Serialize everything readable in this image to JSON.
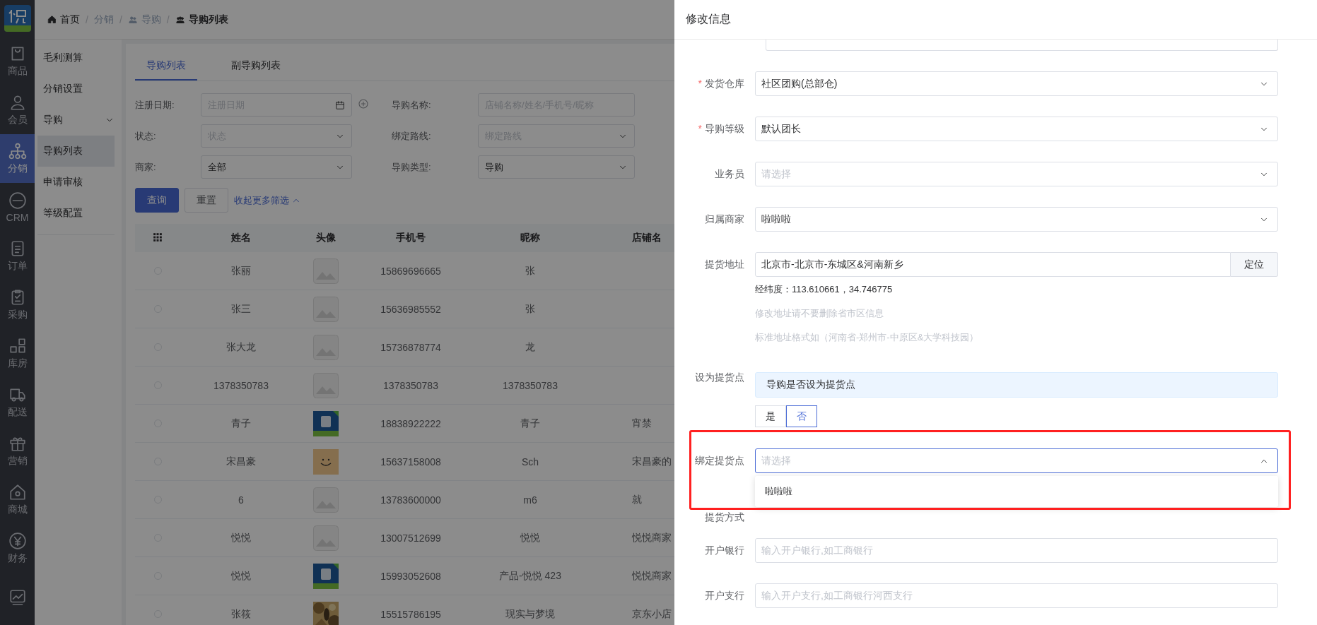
{
  "rail": {
    "items": [
      {
        "label": "商品",
        "selected": false
      },
      {
        "label": "会员",
        "selected": false
      },
      {
        "label": "分销",
        "selected": true
      },
      {
        "label": "CRM",
        "selected": false
      },
      {
        "label": "订单",
        "selected": false
      },
      {
        "label": "采购",
        "selected": false
      },
      {
        "label": "库房",
        "selected": false
      },
      {
        "label": "配送",
        "selected": false
      },
      {
        "label": "营销",
        "selected": false
      },
      {
        "label": "商城",
        "selected": false
      },
      {
        "label": "财务",
        "selected": false
      },
      {
        "selected": false
      }
    ]
  },
  "breadcrumb": [
    {
      "label": "首页"
    },
    {
      "separator": "/",
      "label": "分销"
    },
    {
      "separator": "/",
      "label": "导购"
    },
    {
      "separator": "/",
      "label": "导购列表"
    }
  ],
  "submenu": {
    "items": [
      {
        "label": "毛利测算",
        "selected": false
      },
      {
        "label": "分销设置",
        "selected": false
      },
      {
        "label": "导购",
        "selected": false,
        "expanded": true,
        "children": [
          {
            "label": "导购列表",
            "selected": true
          },
          {
            "label": "申请审核",
            "selected": false
          },
          {
            "label": "等级配置",
            "selected": false
          }
        ]
      }
    ]
  },
  "tabs": [
    {
      "label": "导购列表",
      "selected": true
    },
    {
      "label": "副导购列表",
      "selected": false
    }
  ],
  "filters": [
    {
      "label": "注册日期:",
      "kind": "date",
      "placeholder": "注册日期"
    },
    {
      "label": "导购名称:",
      "kind": "text",
      "placeholder": "店铺名称/姓名/手机号/昵称"
    },
    {
      "label": "状态:",
      "kind": "select",
      "placeholder": "状态"
    },
    {
      "label": "绑定路线:",
      "kind": "select",
      "placeholder": "绑定路线"
    },
    {
      "label": "商家:",
      "kind": "select",
      "value": "全部"
    },
    {
      "label": "导购类型:",
      "kind": "select",
      "value": "导购"
    }
  ],
  "filter_actions": {
    "query": "查询",
    "reset": "重置",
    "toggle": "收起更多筛选"
  },
  "table": {
    "columns": [
      "姓名",
      "头像",
      "手机号",
      "昵称",
      "店铺名"
    ],
    "rows": [
      {
        "selected": false,
        "name": "张丽",
        "avatar": {
          "kind": "placeholder"
        },
        "phone": "15869696665",
        "nickname": "张"
      },
      {
        "selected": false,
        "name": "张三",
        "avatar": {
          "kind": "placeholder"
        },
        "phone": "15636985552",
        "nickname": "张"
      },
      {
        "selected": false,
        "name": "张大龙",
        "avatar": {
          "kind": "placeholder"
        },
        "phone": "15736878774",
        "nickname": "龙"
      },
      {
        "selected": false,
        "name": "1378350783",
        "avatar": {
          "kind": "placeholder"
        },
        "phone": "1378350783",
        "nickname": "1378350783"
      },
      {
        "selected": false,
        "name": "青子",
        "avatar": {
          "kind": "logo"
        },
        "phone": "18838922222",
        "nickname": "青子",
        "store": "宵禁"
      },
      {
        "selected": false,
        "name": "宋昌豪",
        "avatar": {
          "kind": "smiley"
        },
        "phone": "15637158008",
        "nickname": "Sch",
        "store": "宋昌豪的"
      },
      {
        "selected": false,
        "name": "6",
        "avatar": {
          "kind": "placeholder"
        },
        "phone": "13783600000",
        "nickname": "m6",
        "store": "就"
      },
      {
        "selected": false,
        "name": "悦悦",
        "avatar": {
          "kind": "placeholder"
        },
        "phone": "13007512699",
        "nickname": "悦悦",
        "store": "悦悦商家"
      },
      {
        "selected": false,
        "name": "悦悦",
        "avatar": {
          "kind": "logo"
        },
        "phone": "15993052608",
        "nickname": "产品-悦悦 423",
        "store": "悦悦商家"
      },
      {
        "selected": false,
        "name": "张筱",
        "phone": "15515786195",
        "nickname": "现实与梦境",
        "store": "京东小店"
      }
    ]
  },
  "drawer": {
    "title": "修改信息",
    "fields": [
      {
        "label": "发货仓库",
        "required_mark": "*",
        "kind": "select",
        "value": "社区团购(总部仓)",
        "expanded": false,
        "highlighted": false
      },
      {
        "label": "导购等级",
        "required_mark": "*",
        "kind": "select",
        "value": "默认团长",
        "expanded": false,
        "highlighted": false
      },
      {
        "label": "业务员",
        "kind": "select",
        "placeholder": "请选择",
        "expanded": false,
        "highlighted": false
      },
      {
        "label": "归属商家",
        "kind": "select",
        "value": "啦啦啦",
        "expanded": false,
        "highlighted": false
      },
      {
        "label": "提货地址",
        "kind": "address",
        "value": "北京市-北京市-东城区&河南新乡",
        "button": "定位",
        "coords": "经纬度：113.610661，34.746775",
        "hints": [
          "修改地址请不要删除省市区信息",
          "标准地址格式如（河南省-郑州市-中原区&大学科技园）"
        ],
        "highlighted": false
      },
      {
        "label": "设为提货点",
        "kind": "choice",
        "notice": "导购是否设为提货点",
        "options": [
          {
            "label": "是",
            "selected": false
          },
          {
            "label": "否",
            "selected": true
          }
        ],
        "highlighted": false
      },
      {
        "label": "绑定提货点",
        "kind": "select",
        "placeholder": "请选择",
        "expanded": true,
        "options": [
          "啦啦啦"
        ],
        "highlighted": true
      },
      {
        "label": "提货方式",
        "kind": "label",
        "highlighted": false
      },
      {
        "label": "开户银行",
        "kind": "text",
        "placeholder": "输入开户银行,如工商银行",
        "highlighted": false
      },
      {
        "label": "开户支行",
        "kind": "text",
        "placeholder": "输入开户支行,如工商银行河西支行",
        "highlighted": false
      }
    ]
  }
}
